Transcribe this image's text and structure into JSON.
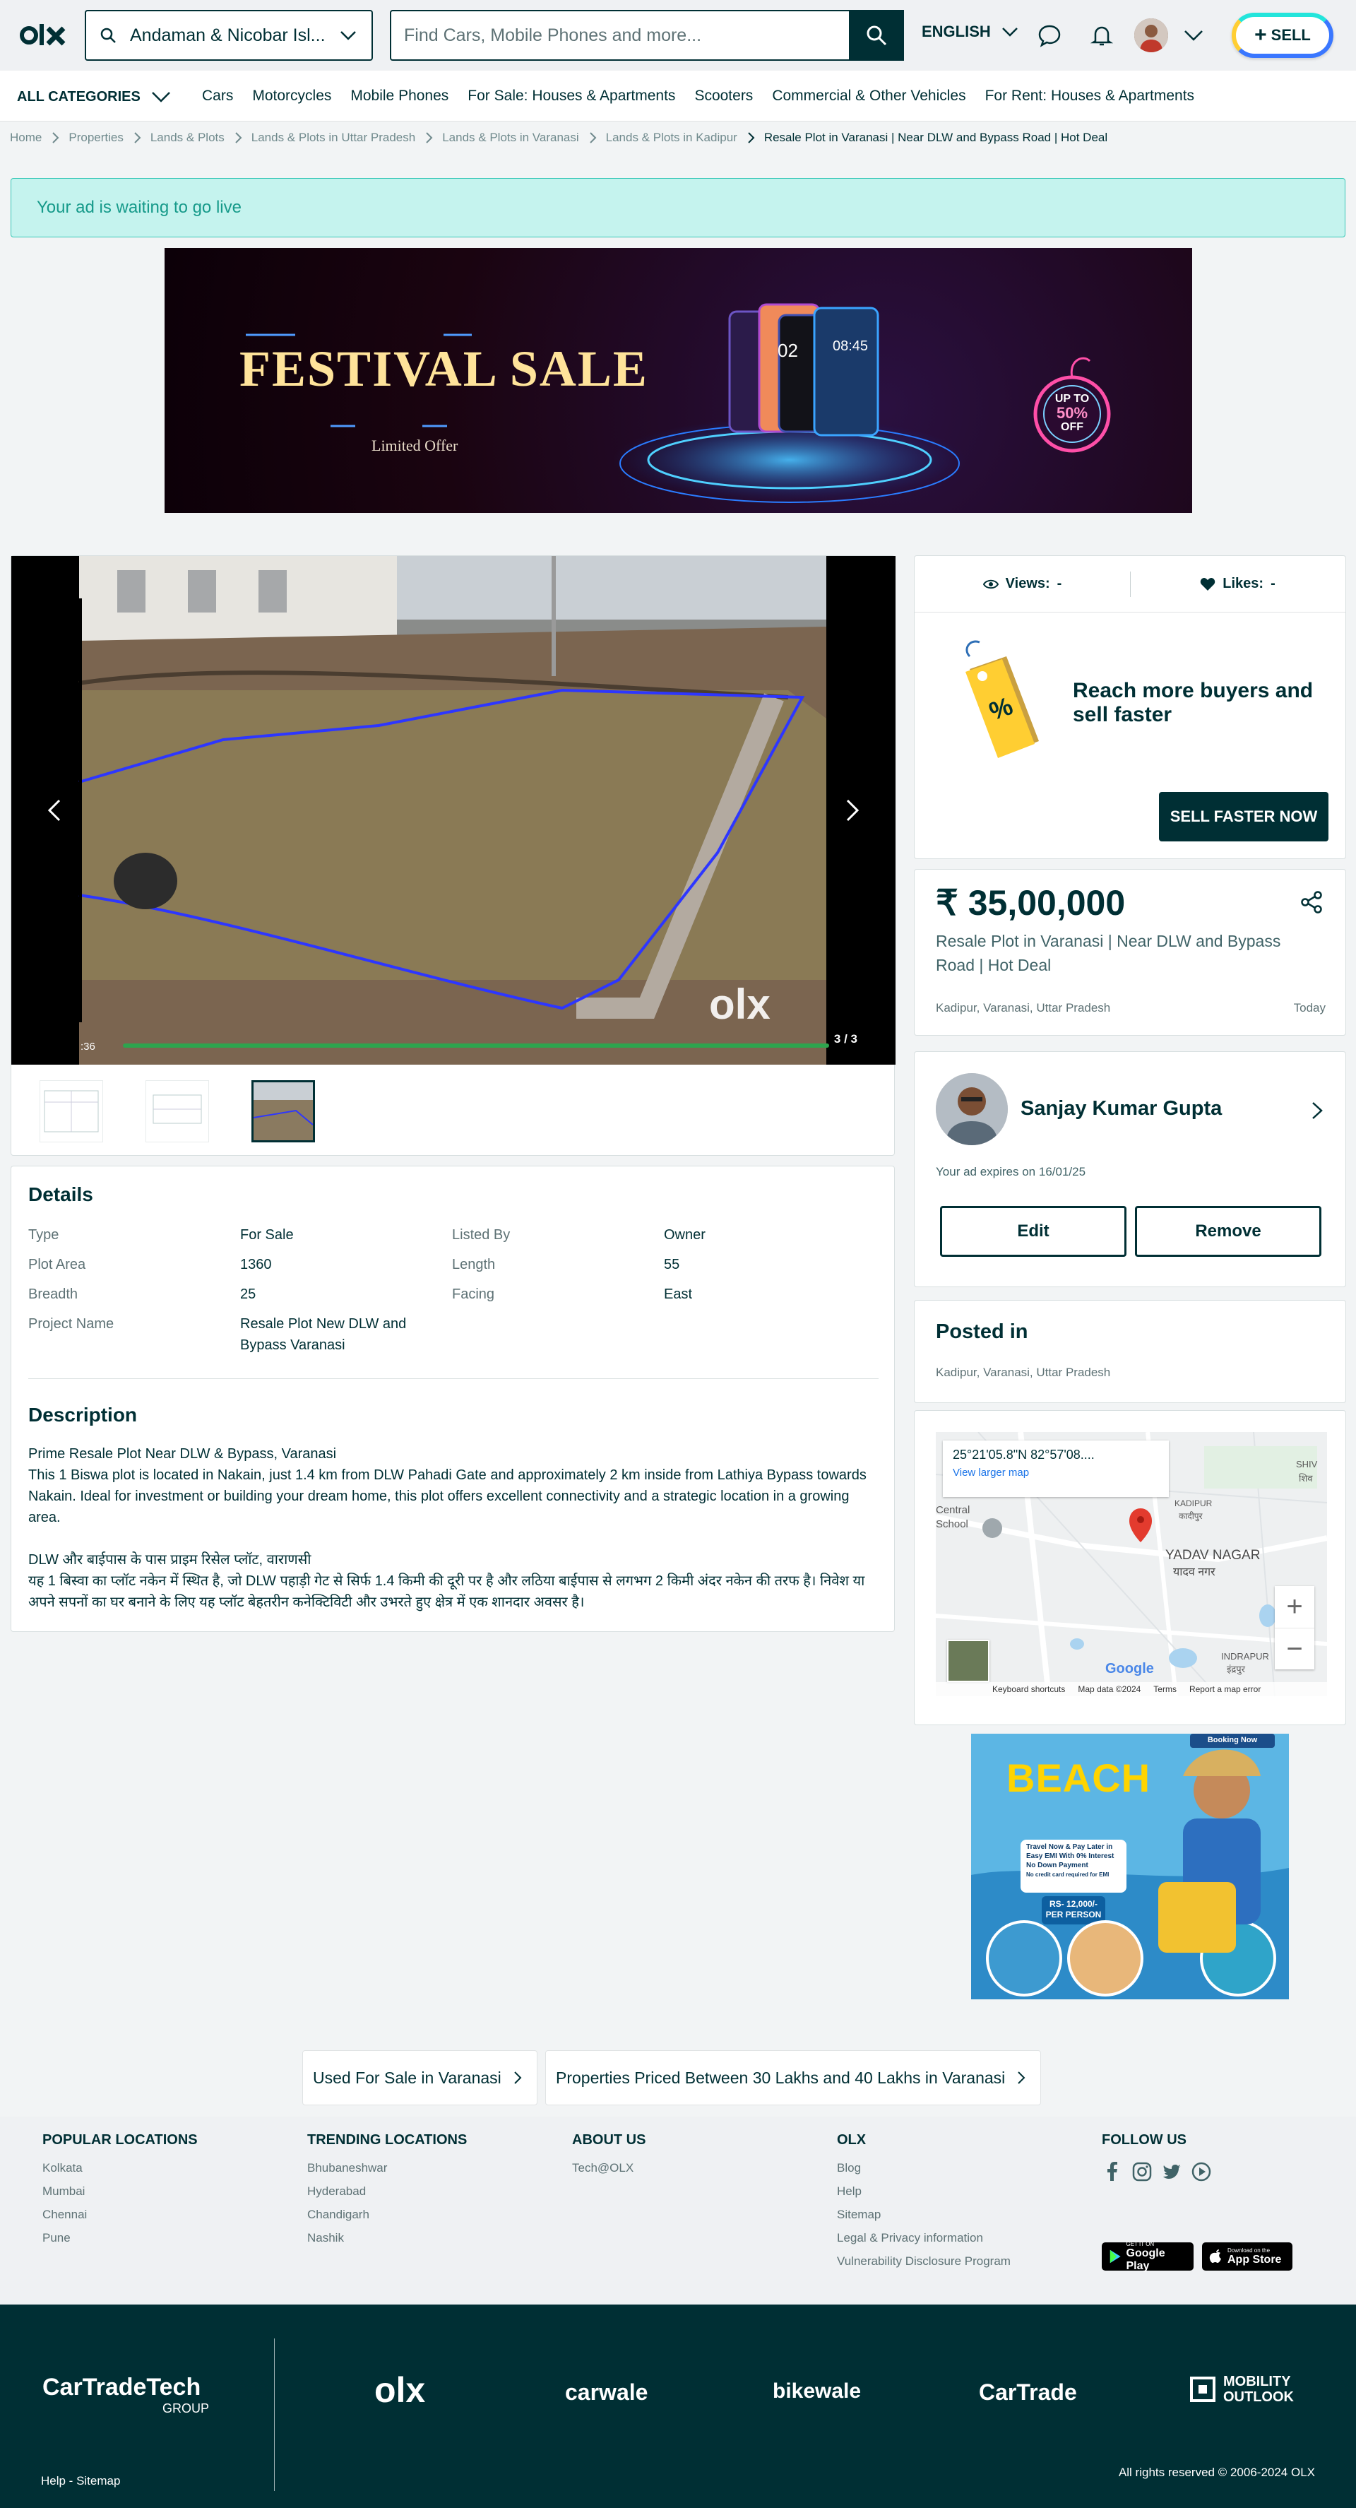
{
  "header": {
    "location": "Andaman & Nicobar Isl...",
    "search_placeholder": "Find Cars, Mobile Phones and more...",
    "language": "ENGLISH",
    "sell_label": "SELL"
  },
  "categories": {
    "all_label": "ALL CATEGORIES",
    "items": [
      "Cars",
      "Motorcycles",
      "Mobile Phones",
      "For Sale: Houses & Apartments",
      "Scooters",
      "Commercial & Other Vehicles",
      "For Rent: Houses & Apartments"
    ]
  },
  "breadcrumb": [
    "Home",
    "Properties",
    "Lands & Plots",
    "Lands & Plots in Uttar Pradesh",
    "Lands & Plots in Varanasi",
    "Lands & Plots in Kadipur",
    "Resale Plot in Varanasi | Near DLW and Bypass Road | Hot Deal"
  ],
  "alert": "Your ad is waiting to go live",
  "banner": {
    "title": "FESTIVAL SALE",
    "subtitle": "Limited Offer",
    "badge_line1": "UP TO",
    "badge_line2": "50%",
    "badge_line3": "OFF",
    "phone1": "02",
    "phone2": "08:45"
  },
  "gallery": {
    "counter": "3 / 3",
    "time": ":36",
    "watermark": "olx"
  },
  "details": {
    "heading": "Details",
    "rows": [
      {
        "l1": "Type",
        "v1": "For Sale",
        "l2": "Listed By",
        "v2": "Owner"
      },
      {
        "l1": "Plot Area",
        "v1": "1360",
        "l2": "Length",
        "v2": "55"
      },
      {
        "l1": "Breadth",
        "v1": "25",
        "l2": "Facing",
        "v2": "East"
      },
      {
        "l1": "Project Name",
        "v1": "Resale Plot New DLW and Bypass Varanasi",
        "l2": "",
        "v2": ""
      }
    ],
    "desc_heading": "Description",
    "description": "Prime Resale Plot Near DLW & Bypass, Varanasi\nThis 1 Biswa plot is located in Nakain, just 1.4 km from DLW Pahadi Gate and approximately 2 km inside from Lathiya Bypass towards Nakain. Ideal for investment or building your dream home, this plot offers excellent connectivity and a strategic location in a growing area.\n\nDLW और बाईपास के पास प्राइम रिसेल प्लॉट, वाराणसी\nयह 1 बिस्वा का प्लॉट नकेन में स्थित है, जो DLW पहाड़ी गेट से सिर्फ 1.4 किमी की दूरी पर है और लठिया बाईपास से लगभग 2 किमी अंदर नकेन की तरफ है। निवेश या अपने सपनों का घर बनाने के लिए यह प्लॉट बेहतरीन कनेक्टिविटी और उभरते हुए क्षेत्र में एक शानदार अवसर है।"
  },
  "stats": {
    "views_label": "Views:",
    "views_value": "-",
    "likes_label": "Likes:",
    "likes_value": "-",
    "promo_text": "Reach more buyers and sell faster",
    "promo_button": "SELL FASTER NOW"
  },
  "price": {
    "amount": "₹ 35,00,000",
    "title": "Resale Plot in Varanasi | Near DLW and Bypass Road | Hot Deal",
    "location": "Kadipur, Varanasi, Uttar Pradesh",
    "date": "Today"
  },
  "seller": {
    "name": "Sanjay Kumar Gupta",
    "expires": "Your ad expires on 16/01/25",
    "edit_label": "Edit",
    "remove_label": "Remove"
  },
  "posted": {
    "heading": "Posted in",
    "location": "Kadipur, Varanasi, Uttar Pradesh"
  },
  "map": {
    "coords": "25°21'05.8\"N 82°57'08....",
    "larger": "View larger map",
    "label_kadipur": "KADIPUR",
    "label_kadipur_hi": "कादीपुर",
    "label_yadav": "YADAV NAGAR",
    "label_yadav_hi": "यादव नगर",
    "label_central": "Central",
    "label_school": "School",
    "label_indrapur": "INDRAPUR",
    "label_indrapur_hi": "इंद्रपुर",
    "label_shiv": "SHIV",
    "label_shiv_hi": "शिव",
    "google": "Google",
    "shortcuts": "Keyboard shortcuts",
    "mapdata": "Map data ©2024",
    "terms": "Terms",
    "report": "Report a map error"
  },
  "ad": {
    "booking": "Booking Now",
    "title": "BEACH",
    "line1": "Travel Now & Pay Later in",
    "line2": "Easy EMI With 0% Interest",
    "line3": "No Down Payment",
    "line4": "No credit card required for EMI",
    "price1": "RS- 12,000/-",
    "price2": "PER PERSON"
  },
  "bottom_links": [
    "Used For Sale in Varanasi",
    "Properties Priced Between 30 Lakhs and 40 Lakhs in Varanasi"
  ],
  "footer": {
    "popular": {
      "h": "POPULAR LOCATIONS",
      "items": [
        "Kolkata",
        "Mumbai",
        "Chennai",
        "Pune"
      ]
    },
    "trending": {
      "h": "TRENDING LOCATIONS",
      "items": [
        "Bhubaneshwar",
        "Hyderabad",
        "Chandigarh",
        "Nashik"
      ]
    },
    "about": {
      "h": "ABOUT US",
      "items": [
        "Tech@OLX"
      ]
    },
    "olx": {
      "h": "OLX",
      "items": [
        "Blog",
        "Help",
        "Sitemap",
        "Legal & Privacy information",
        "Vulnerability Disclosure Program"
      ]
    },
    "follow": {
      "h": "FOLLOW US"
    },
    "gplay_small": "GET IT ON",
    "gplay_big": "Google Play",
    "appstore_small": "Download on the",
    "appstore_big": "App Store"
  },
  "bottom": {
    "cartrade_tech": "CarTradeTech",
    "group": "GROUP",
    "olx": "olx",
    "carwale": "carwale",
    "bikewale": "bikewale",
    "cartrade": "CarTrade",
    "mobility1": "MOBILITY",
    "mobility2": "OUTLOOK",
    "help": "Help - Sitemap",
    "rights": "All rights reserved © 2006-2024 OLX"
  }
}
